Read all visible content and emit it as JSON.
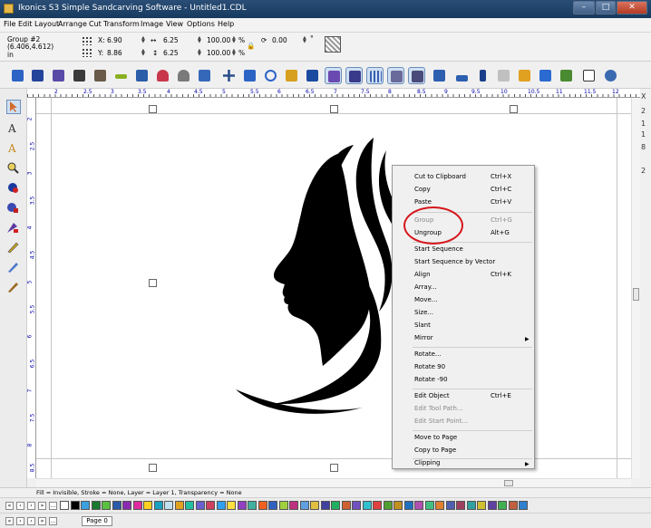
{
  "window": {
    "title": "Ikonics S3 Simple Sandcarving Software - Untitled1.CDL"
  },
  "menu": [
    "File",
    "Edit",
    "Layout",
    "Arrange",
    "Cut",
    "Transform",
    "Image",
    "View",
    "Options",
    "Help"
  ],
  "props": {
    "group_label": "Group #2",
    "group_size": "(6.406,4.612)",
    "units": "in",
    "x_label": "X:",
    "x_value": "6.90",
    "y_label": "Y:",
    "y_value": "8.86",
    "w_value": "6.25",
    "h_value": "6.25",
    "scale_w": "100.00",
    "scale_h": "100.00",
    "rotation": "0.00"
  },
  "toolbar_icons": [
    "open-icon",
    "save-icon",
    "print-icon",
    "import-icon",
    "export-icon",
    "brush-icon",
    "scan-icon",
    "undo-icon",
    "redo-icon",
    "zoom-icon",
    "move-icon",
    "node-icon",
    "rotate-icon",
    "fill-icon",
    "contour-icon",
    "select-icon",
    "eye-icon",
    "grid-icon",
    "magnet-icon",
    "cursor-icon",
    "table-icon",
    "bars-icon",
    "ruler-icon",
    "star-icon",
    "magic-icon",
    "bucket-icon",
    "hand-icon",
    "zoom-in-icon"
  ],
  "ruler_h": [
    "2",
    "2.5",
    "3",
    "3.5",
    "4",
    "4.5",
    "5",
    "5.5",
    "6",
    "6.5",
    "7",
    "7.5",
    "8",
    "8.5",
    "9",
    "9.5",
    "10",
    "10.5",
    "11",
    "11.5",
    "12"
  ],
  "ruler_v": [
    "2",
    "2.5",
    "3",
    "3.5",
    "4",
    "4.5",
    "5",
    "5.5",
    "6",
    "6.5",
    "7",
    "7.5",
    "8",
    "8.5"
  ],
  "status": "Fill = Invisible, Stroke = None, Layer = Layer 1, Transparency = None",
  "page_tab": "Page 0",
  "right_panel": [
    "X",
    "2",
    "1",
    "1",
    "8",
    "2"
  ],
  "context_menu": [
    {
      "label": "Cut to Clipboard",
      "shortcut": "Ctrl+X",
      "enabled": true
    },
    {
      "label": "Copy",
      "shortcut": "Ctrl+C",
      "enabled": true
    },
    {
      "label": "Paste",
      "shortcut": "Ctrl+V",
      "enabled": true
    },
    {
      "label": "Group",
      "shortcut": "Ctrl+G",
      "enabled": false
    },
    {
      "label": "Ungroup",
      "shortcut": "Alt+G",
      "enabled": true,
      "highlight": true
    },
    {
      "label": "Start Sequence",
      "shortcut": "",
      "enabled": true
    },
    {
      "label": "Start Sequence by Vector",
      "shortcut": "",
      "enabled": true
    },
    {
      "label": "Align",
      "shortcut": "Ctrl+K",
      "enabled": true
    },
    {
      "label": "Array...",
      "shortcut": "",
      "enabled": true
    },
    {
      "label": "Move...",
      "shortcut": "",
      "enabled": true
    },
    {
      "label": "Size...",
      "shortcut": "",
      "enabled": true
    },
    {
      "label": "Slant",
      "shortcut": "",
      "enabled": true
    },
    {
      "label": "Mirror",
      "shortcut": "",
      "enabled": true,
      "submenu": true
    },
    {
      "label": "Rotate...",
      "shortcut": "",
      "enabled": true
    },
    {
      "label": "Rotate 90",
      "shortcut": "",
      "enabled": true
    },
    {
      "label": "Rotate -90",
      "shortcut": "",
      "enabled": true
    },
    {
      "label": "Edit Object",
      "shortcut": "Ctrl+E",
      "enabled": true
    },
    {
      "label": "Edit Tool Path...",
      "shortcut": "",
      "enabled": false
    },
    {
      "label": "Edit Start Point...",
      "shortcut": "",
      "enabled": false
    },
    {
      "label": "Move to Page",
      "shortcut": "",
      "enabled": true
    },
    {
      "label": "Copy to Page",
      "shortcut": "",
      "enabled": true
    },
    {
      "label": "Clipping",
      "shortcut": "",
      "enabled": true,
      "submenu": true
    }
  ],
  "colors": {
    "accent": "#d6151b",
    "titlebar": "#1f4166",
    "highlight": "#dde8f6"
  }
}
